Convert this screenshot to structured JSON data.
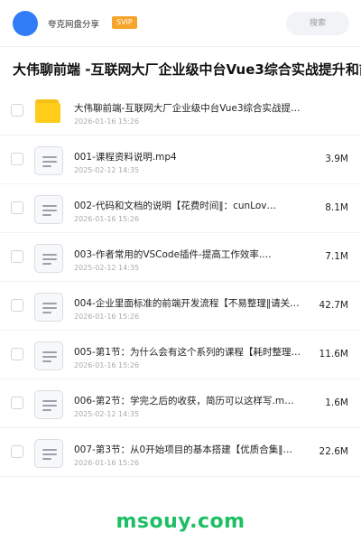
{
  "header": {
    "username": "夸克网盘分享",
    "badge": "SVIP",
    "search_placeholder": "搜索"
  },
  "page_title": "大伟聊前端 -互联网大厂企业级中台Vue3综合实战提升和前",
  "files": [
    {
      "type": "folder",
      "name": "大伟聊前端-互联网大厂企业级中台Vue3综合实战提…",
      "date": "2026-01-16 15:26",
      "size": ""
    },
    {
      "type": "file",
      "name": "001-课程资料说明.mp4",
      "date": "2025-02-12 14:35",
      "size": "3.9M"
    },
    {
      "type": "file",
      "name": "002-代码和文档的说明【花费时间‖：cunLov…",
      "date": "2026-01-16 15:26",
      "size": "8.1M"
    },
    {
      "type": "file",
      "name": "003-作者常用的VSCode插件-提高工作效率.…",
      "date": "2025-02-12 14:35",
      "size": "7.1M"
    },
    {
      "type": "file",
      "name": "004-企业里面标准的前端开发流程【不易整理‖请关…",
      "date": "2026-01-16 15:26",
      "size": "42.7M"
    },
    {
      "type": "file",
      "name": "005-第1节：为什么会有这个系列的课程【耗时整理…",
      "date": "2026-01-16 15:26",
      "size": "11.6M"
    },
    {
      "type": "file",
      "name": "006-第2节：学完之后的收获，简历可以这样写.m…",
      "date": "2025-02-12 14:35",
      "size": "1.6M"
    },
    {
      "type": "file",
      "name": "007-第3节：从0开始项目的基本搭建【优质合集‖…",
      "date": "2026-01-16 15:26",
      "size": "22.6M"
    }
  ],
  "watermark": "msouy.com",
  "colors": {
    "avatar": "#2f7cf6",
    "badge": "#f7a52a",
    "folder": "#ffcc19",
    "watermark": "#1cbf63"
  },
  "icons": {
    "folder": "folder-icon",
    "file": "file-icon"
  }
}
